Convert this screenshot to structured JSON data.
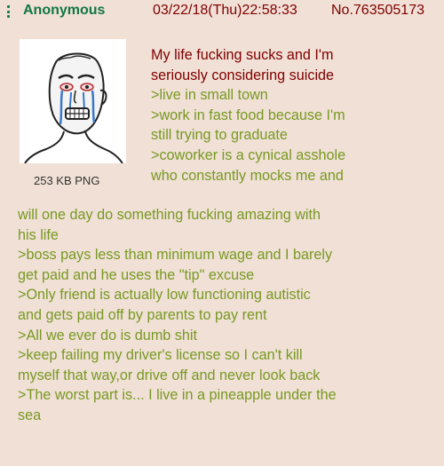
{
  "post": {
    "name": "Anonymous",
    "datetime": "03/22/18(Thu)22:58:33",
    "post_number": "No.763505173",
    "file_size": "253 KB PNG",
    "thumbnail_icon": "crying-wojak-icon",
    "colors": {
      "background": "#f0e0d6",
      "name": "#117743",
      "text": "#800000",
      "greentext": "#789922"
    },
    "lines_right": [
      "My life fucking sucks and I'm",
      "seriously considering suicide",
      ">live in small town",
      ">work in fast food because I'm",
      "still trying to graduate",
      ">coworker is a cynical asshole",
      "who constantly mocks me and"
    ],
    "lines_full": [
      "will one day do something fucking amazing with",
      "his life",
      ">boss pays less than minimum wage and I barely",
      "get paid and he uses the \"tip\" excuse",
      ">Only friend is actually low functioning autistic",
      "and gets paid off by parents to pay rent",
      ">All we ever do is dumb shit",
      ">keep failing my driver's license so I can't kill",
      "myself that way,or drive off and never look back",
      ">The worst part is... I live in a pineapple under the",
      "sea"
    ]
  }
}
